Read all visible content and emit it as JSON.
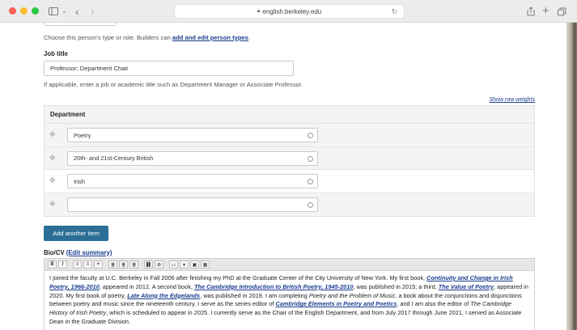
{
  "browser": {
    "url": "english.berkeley.edu"
  },
  "person_type": {
    "help_prefix": "Choose this person's type or role. Builders can ",
    "help_link": "add and edit person types",
    "help_suffix": "."
  },
  "job_title": {
    "label": "Job title",
    "value": "Professor; Department Chair",
    "help": "If applicable, enter a job or academic title such as Department Manager or Associate Professor."
  },
  "department": {
    "show_row_weights": "Show row weights",
    "header": "Department",
    "rows": [
      "Poetry",
      "20th- and 21st-Century British",
      "Irish",
      ""
    ]
  },
  "add_item_label": "Add another item",
  "bio": {
    "label": "Bio/CV",
    "edit_summary": "(Edit summary)",
    "toolbar": [
      "B",
      "I",
      "≡",
      "≡",
      "❝",
      "≣",
      "≣",
      "≣",
      "⛓",
      "⊘",
      "▭",
      "▾",
      "▣",
      "▦"
    ],
    "segments": [
      {
        "t": "text",
        "v": "I joined the faculty at U.C. Berkeley in Fall 2006 after finishing my PhD at the Graduate Center of the City University of New York. My first book, "
      },
      {
        "t": "link",
        "v": "Continuity and Change in Irish Poetry, 1966-2010"
      },
      {
        "t": "text",
        "v": ", appeared in 2012. A second book, "
      },
      {
        "t": "link",
        "v": "The Cambridge Introduction to British Poetry, 1945-2010"
      },
      {
        "t": "text",
        "v": ", was published in 2015; a third, "
      },
      {
        "t": "link",
        "v": "The Value of Poetry"
      },
      {
        "t": "text",
        "v": ", appeared in 2020. My first book of poetry, "
      },
      {
        "t": "link",
        "v": "Late Along the Edgelands"
      },
      {
        "t": "text",
        "v": ", was published in 2019. I am completing "
      },
      {
        "t": "em",
        "v": "Poetry and the Problem of Music"
      },
      {
        "t": "text",
        "v": ", a book about the conjunctions and disjunctions between poetry and music since the nineteenth century. I serve as the series editor of "
      },
      {
        "t": "link",
        "v": "Cambridge Elements in Poetry and Poetics"
      },
      {
        "t": "text",
        "v": ", and I am also the editor of "
      },
      {
        "t": "em",
        "v": "The Cambridge History of Irish Poetry"
      },
      {
        "t": "text",
        "v": ", which is scheduled to appear in 2025. I currently serve as the Chair of the English Department, and from July 2017 through June 2021, I served as Associate Dean in the Graduate Division."
      }
    ]
  }
}
